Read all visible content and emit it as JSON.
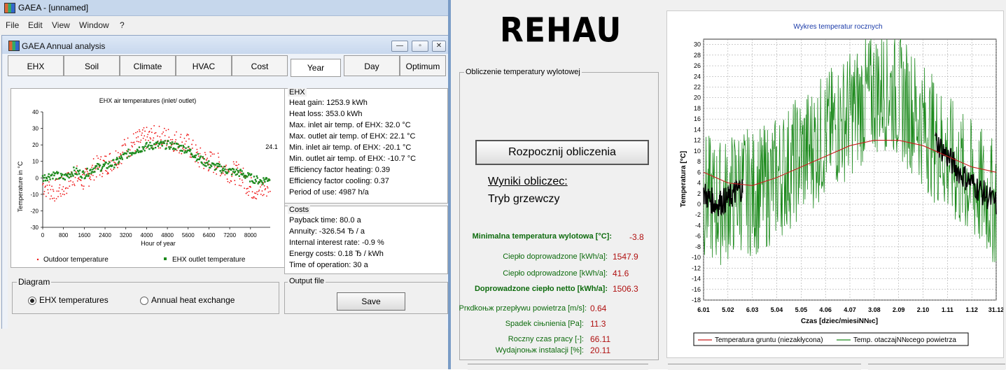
{
  "gaea": {
    "window_title": "GAEA - [unnamed]",
    "menu": [
      "File",
      "Edit",
      "View",
      "Window",
      "?"
    ],
    "child_title": "GAEA Annual analysis",
    "child_buttons": {
      "minimize": "—",
      "restore": "▫",
      "close": "✕"
    },
    "tabs": [
      "EHX",
      "Soil",
      "Climate",
      "HVAC",
      "Cost",
      "Year",
      "Day",
      "Optimum"
    ],
    "active_tab": "Year",
    "ehx_panel": {
      "title": "EHX",
      "lines": [
        "Heat gain: 1253.9 kWh",
        "Heat loss: 353.0 kWh",
        "Max. inlet air temp. of EHX: 32.0 °C",
        "Max. outlet air temp. of EHX: 22.1 °C",
        "Min. inlet air temp. of EHX: -20.1 °C",
        "Min. outlet air temp. of EHX: -10.7 °C",
        "Efficiency factor heating: 0.39",
        "Efficiency factor cooling: 0.37",
        "Period of use: 4987 h/a"
      ]
    },
    "costs_panel": {
      "title": "Costs",
      "lines": [
        "Payback time: 80.0 a",
        "Annuity: -326.54 Ђ / a",
        "Internal interest rate: -0.9 %",
        "Energy costs: 0.18 Ђ / kWh",
        "Time of operation: 30 a"
      ]
    },
    "diagram": {
      "title": "Diagram",
      "options": [
        "EHX temperatures",
        "Annual heat exchange"
      ],
      "selected": "EHX temperatures"
    },
    "output_file": {
      "title": "Output file",
      "save_label": "Save"
    }
  },
  "rehau": {
    "logo": "REHAU",
    "logo_mark": "®",
    "group_title": "Obliczenie temperatury wylotowej",
    "start_button": "Rozpocznij obliczenia",
    "results_heading": "Wyniki obliczec:",
    "mode": "Tryb grzewczy",
    "results": [
      {
        "label": "Minimalna temperatura wylotowa [°C]:",
        "value": "-3.8",
        "bold": true
      },
      {
        "label": "Ciepło doprowadzone [kWh/a]:",
        "value": "1547.9",
        "bold": false
      },
      {
        "label": "Ciepło odprowadzone  [kWh/a]:",
        "value": "41.6",
        "bold": false
      },
      {
        "label": "Doprowadzone ciepło netto [kWh/a]:",
        "value": "1506.3",
        "bold": true
      },
      {
        "label": "Prкdkoњж przepływu powietrza [m/s]:",
        "value": "0.64",
        "bold": false
      },
      {
        "label": "Spadek ciњnienia [Pa]:",
        "value": "11.3",
        "bold": false
      },
      {
        "label": "Roczny czas pracy [-]:",
        "value": "66.11",
        "bold": false
      },
      {
        "label": "Wydajnoњж instalacji [%]:",
        "value": "20.11",
        "bold": false
      }
    ]
  },
  "colors": {
    "red_series": "#ee1111",
    "green_series": "#1d8a1d",
    "black_series": "#000000",
    "ground_line": "#c81e1e",
    "results_label": "#0d6b0d",
    "results_value": "#b01010"
  },
  "chart_data": [
    {
      "type": "scatter",
      "title": "EHX air temperatures (inlet/ outlet)",
      "xlabel": "Hour of year",
      "ylabel": "Temperature in °C",
      "xlim": [
        0,
        8760
      ],
      "ylim": [
        -30,
        40
      ],
      "x_ticks": [
        0,
        800,
        1600,
        2400,
        3200,
        4000,
        4800,
        5600,
        6400,
        7200,
        8000
      ],
      "y_ticks": [
        -30,
        -20,
        -10,
        0,
        10,
        20,
        30,
        40
      ],
      "annotation": "24.1",
      "legend_position": "bottom",
      "series": [
        {
          "name": "Outdoor temperature",
          "color": "#ee1111",
          "x": [
            0,
            400,
            800,
            1200,
            1600,
            2000,
            2400,
            2800,
            3200,
            3600,
            4000,
            4400,
            4800,
            5200,
            5600,
            6000,
            6400,
            6800,
            7200,
            7600,
            8000,
            8400,
            8760
          ],
          "values": [
            -4,
            -8,
            -6,
            2,
            -2,
            6,
            8,
            12,
            18,
            22,
            24,
            25,
            24,
            22,
            20,
            12,
            10,
            8,
            4,
            2,
            -6,
            -8,
            -4
          ]
        },
        {
          "name": "EHX outlet temperature",
          "color": "#1d8a1d",
          "x": [
            0,
            400,
            800,
            1200,
            1600,
            2000,
            2400,
            2800,
            3200,
            3600,
            4000,
            4400,
            4800,
            5200,
            5600,
            6000,
            6400,
            6800,
            7200,
            7600,
            8000,
            8400,
            8760
          ],
          "values": [
            0,
            2,
            0,
            4,
            2,
            6,
            7,
            9,
            14,
            17,
            19,
            20,
            20,
            19,
            17,
            12,
            8,
            6,
            4,
            3,
            0,
            -2,
            0
          ]
        }
      ]
    },
    {
      "type": "line",
      "title": "Wykres temperatur rocznych",
      "xlabel": "Czas [dziec/miesiN№c]",
      "ylabel": "Temperatura [°C]",
      "ylim": [
        -18,
        31
      ],
      "x_ticks": [
        "6.01",
        "5.02",
        "6.03",
        "5.04",
        "5.05",
        "4.06",
        "4.07",
        "3.08",
        "2.09",
        "2.10",
        "1.11",
        "1.12",
        "31.12"
      ],
      "y_ticks": [
        -18,
        -16,
        -14,
        -12,
        -10,
        -8,
        -6,
        -4,
        -2,
        0,
        2,
        4,
        6,
        8,
        10,
        12,
        14,
        16,
        18,
        20,
        22,
        24,
        26,
        28,
        30
      ],
      "legend_position": "bottom",
      "series": [
        {
          "name": "Temperatura gruntu (niezakłycona)",
          "color": "#c81e1e",
          "x": [
            0,
            1,
            2,
            3,
            4,
            5,
            6,
            7,
            8,
            9,
            10,
            11,
            12
          ],
          "values": [
            6,
            4,
            3.5,
            5,
            7,
            9,
            11,
            12,
            12,
            11,
            9,
            7,
            6
          ]
        },
        {
          "name": "Temp. otaczajN№cego powietrza",
          "color": "#000000",
          "x": [
            0,
            0.5,
            1,
            1.5,
            2,
            2.5,
            3,
            3.5,
            4,
            4.5,
            5,
            5.5,
            6,
            6.5,
            7,
            7.5,
            8,
            8.5,
            9,
            9.5,
            10,
            10.5,
            11,
            11.5,
            12
          ],
          "values": [
            2,
            0,
            1,
            3,
            2,
            3,
            5,
            7,
            9,
            11,
            13,
            15,
            17,
            19,
            21,
            22,
            20,
            18,
            15,
            12,
            9,
            6,
            4,
            2,
            0
          ]
        }
      ]
    }
  ]
}
